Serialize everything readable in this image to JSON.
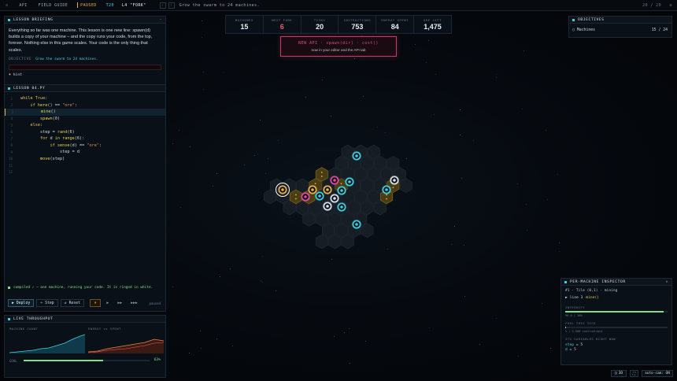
{
  "topbar": {
    "api": "API",
    "field_guide": "FIELD GUIDE",
    "status": "PAUSED",
    "tick": "T20",
    "lesson": "L4 \"FORK\"",
    "goal": "Grow the swarm to 24 machines.",
    "progress": "20 / 20"
  },
  "stats": [
    {
      "label": "MACHINES",
      "value": "15",
      "color": "#e6eef6"
    },
    {
      "label": "NEXT FORK",
      "value": "6",
      "color": "#ef5a6b"
    },
    {
      "label": "TICKS",
      "value": "20",
      "color": "#e6eef6"
    },
    {
      "label": "INSTRUCTIONS",
      "value": "753",
      "color": "#e6eef6"
    },
    {
      "label": "ENERGY SPENT",
      "value": "84",
      "color": "#e6eef6"
    },
    {
      "label": "ORE LEFT",
      "value": "1,475",
      "color": "#e6eef6"
    }
  ],
  "notice": {
    "title": "NEW API · spawn(dir) · cost()",
    "subtitle": "now in your editor and the API tab"
  },
  "briefing": {
    "title": "LESSON BRIEFING",
    "body": "Everything so far was one machine. This lesson is one new line: spawn(d) builds a copy of your machine – and the copy runs your code, from the top, forever. Nothing else in this game scales. Your code is the only thing that scales.",
    "objective_label": "OBJECTIVE",
    "objective": "Grow the swarm to 24 machines.",
    "hint": "hint"
  },
  "editor": {
    "title": "LESSON 04.PY",
    "lines": [
      [
        {
          "t": "while ",
          "c": "kw"
        },
        {
          "t": "True",
          "c": "kw"
        },
        {
          "t": ":",
          "c": ""
        }
      ],
      [
        {
          "t": "    if ",
          "c": "kw"
        },
        {
          "t": "here",
          "c": "fn"
        },
        {
          "t": "() == ",
          "c": ""
        },
        {
          "t": "\"ore\"",
          "c": "st"
        },
        {
          "t": ":",
          "c": ""
        }
      ],
      [
        {
          "t": "        ",
          "c": ""
        },
        {
          "t": "mine",
          "c": "fn"
        },
        {
          "t": "()",
          "c": ""
        }
      ],
      [
        {
          "t": "        ",
          "c": ""
        },
        {
          "t": "spawn",
          "c": "fn"
        },
        {
          "t": "(0)",
          "c": ""
        }
      ],
      [
        {
          "t": "    else",
          "c": "kw"
        },
        {
          "t": ":",
          "c": ""
        }
      ],
      [
        {
          "t": "        step = ",
          "c": ""
        },
        {
          "t": "rand",
          "c": "fn"
        },
        {
          "t": "(6)",
          "c": ""
        }
      ],
      [
        {
          "t": "        for ",
          "c": "kw"
        },
        {
          "t": "d ",
          "c": ""
        },
        {
          "t": "in ",
          "c": "kw"
        },
        {
          "t": "range",
          "c": "fn"
        },
        {
          "t": "(6):",
          "c": ""
        }
      ],
      [
        {
          "t": "            if ",
          "c": "kw"
        },
        {
          "t": "sense",
          "c": "fn"
        },
        {
          "t": "(d) == ",
          "c": ""
        },
        {
          "t": "\"ore\"",
          "c": "st"
        },
        {
          "t": ":",
          "c": ""
        }
      ],
      [
        {
          "t": "                step = d",
          "c": ""
        }
      ],
      [
        {
          "t": "        ",
          "c": ""
        },
        {
          "t": "move",
          "c": "fn"
        },
        {
          "t": "(step)",
          "c": ""
        }
      ],
      [],
      []
    ],
    "status": "compiled ✓ — one machine, running your code. It is ringed in white.",
    "deploy": "Deploy",
    "step": "Step",
    "reset": "Reset",
    "speed_paused": "paused"
  },
  "throughput": {
    "title": "LIVE THROUGHPUT",
    "machine_count": "MACHINE COUNT",
    "energy_spent": "ENERGY vs SPENT",
    "goal_label": "GOAL",
    "goal_pct": "63%"
  },
  "objectives": {
    "title": "OBJECTIVES",
    "item": "Machines",
    "count": "15 / 24"
  },
  "inspector": {
    "title": "PER-MACHINE INSPECTOR",
    "id": "#1 · Tile (0,1) · mining",
    "line": "line 3",
    "line_code": "mine()",
    "integrity_label": "INTEGRITY",
    "integrity_val": "96.0 / 100",
    "fuel_label": "FUEL THIS TICK",
    "fuel_val": "1 / 2,500 instructions",
    "vars_label": "ITS VARIABLES RIGHT NOW",
    "var1_name": "step",
    "var1_val": "5",
    "var2_name": "d",
    "var2_val": "5"
  },
  "footer": {
    "view": "3D",
    "autocam": "auto-cam: ON"
  }
}
